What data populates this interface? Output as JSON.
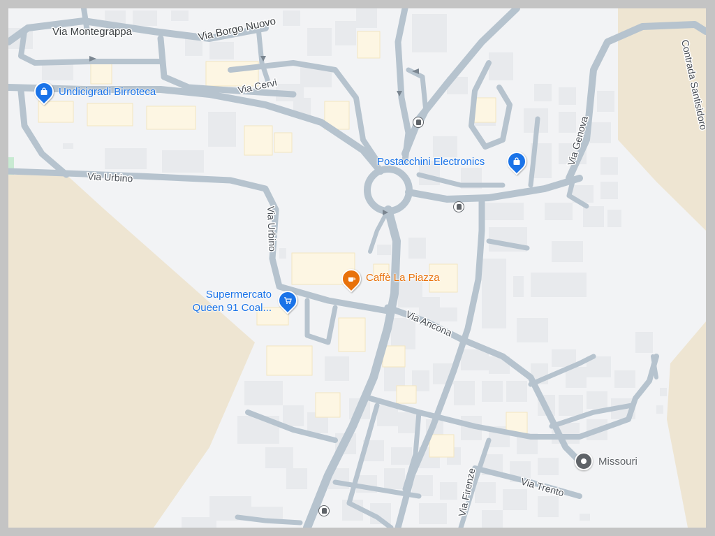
{
  "colors": {
    "background": "#f2f3f5",
    "road": "#b6c3ce",
    "building": "#e8eaed",
    "building_highlight": "#fdf6e3",
    "park": "#eee5d2",
    "poi_blue": "#1a73e8",
    "poi_orange": "#e8710a",
    "poi_grey": "#5f6368"
  },
  "streets": [
    {
      "name": "Via Montegrappa"
    },
    {
      "name": "Via Borgo Nuovo"
    },
    {
      "name": "Via Cervi"
    },
    {
      "name": "Via Urbino"
    },
    {
      "name": "Via Urbino"
    },
    {
      "name": "Via Genova"
    },
    {
      "name": "Contrada Santisidoro"
    },
    {
      "name": "Via Ancona"
    },
    {
      "name": "Via Firenze"
    },
    {
      "name": "Via Trento"
    }
  ],
  "places": [
    {
      "name": "Undicigradi Birroteca",
      "icon": "shopping-bag-icon",
      "color": "blue"
    },
    {
      "name": "Postacchini Electronics",
      "icon": "shopping-bag-icon",
      "color": "blue"
    },
    {
      "name": "Caffè La Piazza",
      "icon": "coffee-cup-icon",
      "color": "orange"
    },
    {
      "name_line1": "Supermercato",
      "name_line2": "Queen 91 Coal...",
      "icon": "shopping-cart-icon",
      "color": "blue"
    },
    {
      "name": "Missouri",
      "icon": "location-dot-icon",
      "color": "grey"
    }
  ],
  "transit_stops": [
    {
      "icon": "bus-stop-icon"
    },
    {
      "icon": "bus-stop-icon"
    },
    {
      "icon": "bus-stop-icon"
    }
  ]
}
